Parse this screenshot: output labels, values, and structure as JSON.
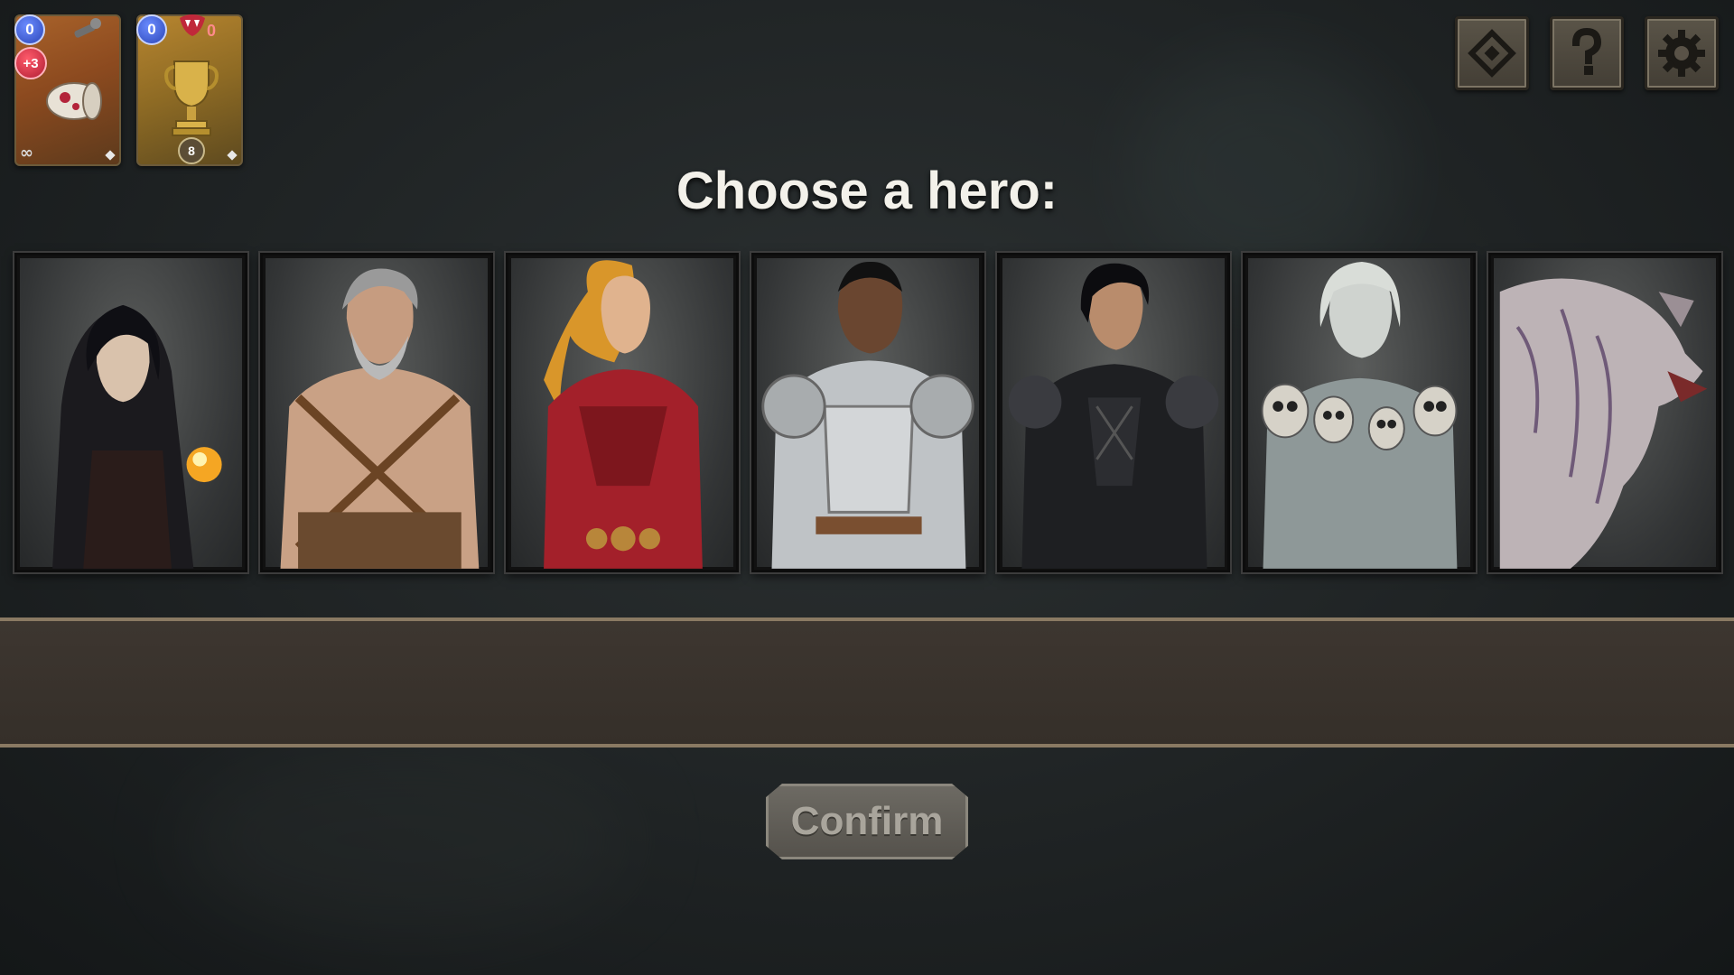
{
  "top_left_cards": [
    {
      "cost": "0",
      "bonus": "+3",
      "icon": "bandage-roll-icon",
      "footer_icon": "infinity-icon",
      "footer_text": "∞"
    },
    {
      "cost": "0",
      "counter": "0",
      "icon": "trophy-icon",
      "charges": "8"
    }
  ],
  "top_right_buttons": [
    {
      "name": "diamond-button",
      "icon": "diamond-icon"
    },
    {
      "name": "help-button",
      "icon": "question-icon"
    },
    {
      "name": "settings-button",
      "icon": "gear-icon"
    }
  ],
  "prompt": "Choose a hero:",
  "heroes": [
    {
      "id": "hooded-sorceress"
    },
    {
      "id": "bearded-barbarian"
    },
    {
      "id": "red-armored-warrior"
    },
    {
      "id": "plate-armored-knight"
    },
    {
      "id": "leather-clad-rogue"
    },
    {
      "id": "skull-armored-warrior"
    },
    {
      "id": "werewolf"
    }
  ],
  "description_panel": {
    "text": ""
  },
  "confirm_label": "Confirm",
  "colors": {
    "band_border": "#8a7a63",
    "band_fill": "#3b342e",
    "cost_badge": "#2c46b8",
    "bonus_badge": "#b01e34"
  }
}
